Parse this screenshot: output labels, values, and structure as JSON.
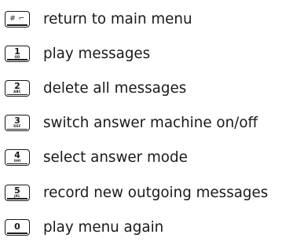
{
  "menu": {
    "items": [
      {
        "key_digit": "# ⌐",
        "key_letters": "",
        "label": "return to main menu"
      },
      {
        "key_digit": "1",
        "key_letters": "QD",
        "label": "play messages"
      },
      {
        "key_digit": "2",
        "key_letters": "ABC",
        "label": "delete all messages"
      },
      {
        "key_digit": "3",
        "key_letters": "DEF",
        "label": "switch answer machine on/off"
      },
      {
        "key_digit": "4",
        "key_letters": "GHI",
        "label": "select answer mode"
      },
      {
        "key_digit": "5",
        "key_letters": "JKL",
        "label": "record new outgoing messages"
      },
      {
        "key_digit": "0",
        "key_letters": "",
        "label": "play menu again"
      }
    ]
  }
}
